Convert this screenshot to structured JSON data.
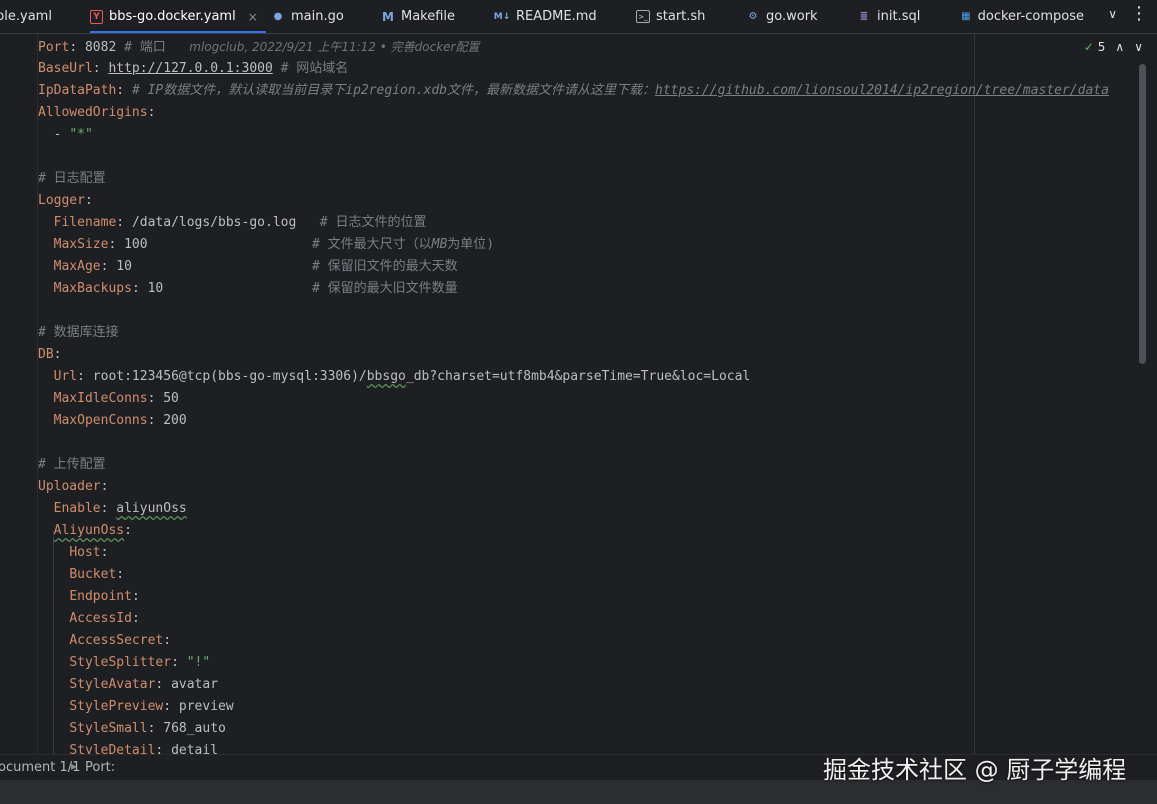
{
  "tabs": [
    {
      "label": "ble.yaml",
      "icon": "yaml-file-icon",
      "active": false
    },
    {
      "label": "bbs-go.docker.yaml",
      "icon": "yaml-file-icon",
      "active": true
    },
    {
      "label": "main.go",
      "icon": "go-file-icon",
      "active": false
    },
    {
      "label": "Makefile",
      "icon": "makefile-icon",
      "active": false
    },
    {
      "label": "README.md",
      "icon": "markdown-file-icon",
      "active": false
    },
    {
      "label": "start.sh",
      "icon": "shell-file-icon",
      "active": false
    },
    {
      "label": "go.work",
      "icon": "go-work-file-icon",
      "active": false
    },
    {
      "label": "init.sql",
      "icon": "sql-file-icon",
      "active": false
    },
    {
      "label": "docker-compose",
      "icon": "docker-file-icon",
      "active": false
    }
  ],
  "tab_close_glyph": "×",
  "inspection": {
    "count": "5"
  },
  "code": {
    "l1": {
      "key": "Port",
      "value": "8082",
      "comment": "# 端口",
      "blame": "mlogclub, 2022/9/21 上午11:12 • 完善docker配置"
    },
    "l2": {
      "key": "BaseUrl",
      "value": "http://127.0.0.1:3000",
      "comment": "# 网站域名"
    },
    "l3": {
      "key": "IpDataPath",
      "comment_a": "# IP数据文件，默认读取当前目录下",
      "comment_b": "ip2region.xdb",
      "comment_c": "文件，最新数据文件请从这里下载：",
      "comment_url": "https://github.com/lionsoul2014/ip2region/tree/master/data"
    },
    "l4": {
      "key": "AllowedOrigins"
    },
    "l5": {
      "dash": "- ",
      "value": "\"*\""
    },
    "l7": {
      "comment": "# 日志配置"
    },
    "l8": {
      "key": "Logger"
    },
    "l9": {
      "key": "Filename",
      "value": "/data/logs/bbs-go.log",
      "comment": "# 日志文件的位置"
    },
    "l10": {
      "key": "MaxSize",
      "value": "100",
      "comment_a": "# 文件最大尺寸（以",
      "comment_b": "MB",
      "comment_c": "为单位)"
    },
    "l11": {
      "key": "MaxAge",
      "value": "10",
      "comment": "# 保留旧文件的最大天数"
    },
    "l12": {
      "key": "MaxBackups",
      "value": "10",
      "comment": "# 保留的最大旧文件数量"
    },
    "l14": {
      "comment": "# 数据库连接"
    },
    "l15": {
      "key": "DB"
    },
    "l16": {
      "key": "Url",
      "value_a": "root:123456@tcp(bbs-go-mysql:3306)/",
      "value_b": "bbsgo",
      "value_c": "_db?charset=utf8mb4&parseTime=True&loc=Local"
    },
    "l17": {
      "key": "MaxIdleConns",
      "value": "50"
    },
    "l18": {
      "key": "MaxOpenConns",
      "value": "200"
    },
    "l20": {
      "comment": "# 上传配置"
    },
    "l21": {
      "key": "Uploader"
    },
    "l22": {
      "key": "Enable",
      "value": "aliyunOss"
    },
    "l23": {
      "key": "AliyunOss"
    },
    "l24": {
      "key": "Host"
    },
    "l25": {
      "key": "Bucket"
    },
    "l26": {
      "key": "Endpoint"
    },
    "l27": {
      "key": "AccessId"
    },
    "l28": {
      "key": "AccessSecret"
    },
    "l29": {
      "key": "StyleSplitter",
      "value": "\"!\""
    },
    "l30": {
      "key": "StyleAvatar",
      "value": "avatar"
    },
    "l31": {
      "key": "StylePreview",
      "value": "preview"
    },
    "l32": {
      "key": "StyleSmall",
      "value": "768_auto"
    },
    "l33": {
      "key": "StyleDetail",
      "value": "detail"
    }
  },
  "statusbar": {
    "document": "ocument 1/1",
    "breadcrumb": "Port:"
  },
  "watermark": "掘金技术社区 @ 厨子学编程",
  "colors": {
    "accent": "#3574f0",
    "key": "#cf8e6d",
    "string": "#6aab73",
    "comment": "#7a7e85",
    "background": "#1e1f22"
  }
}
